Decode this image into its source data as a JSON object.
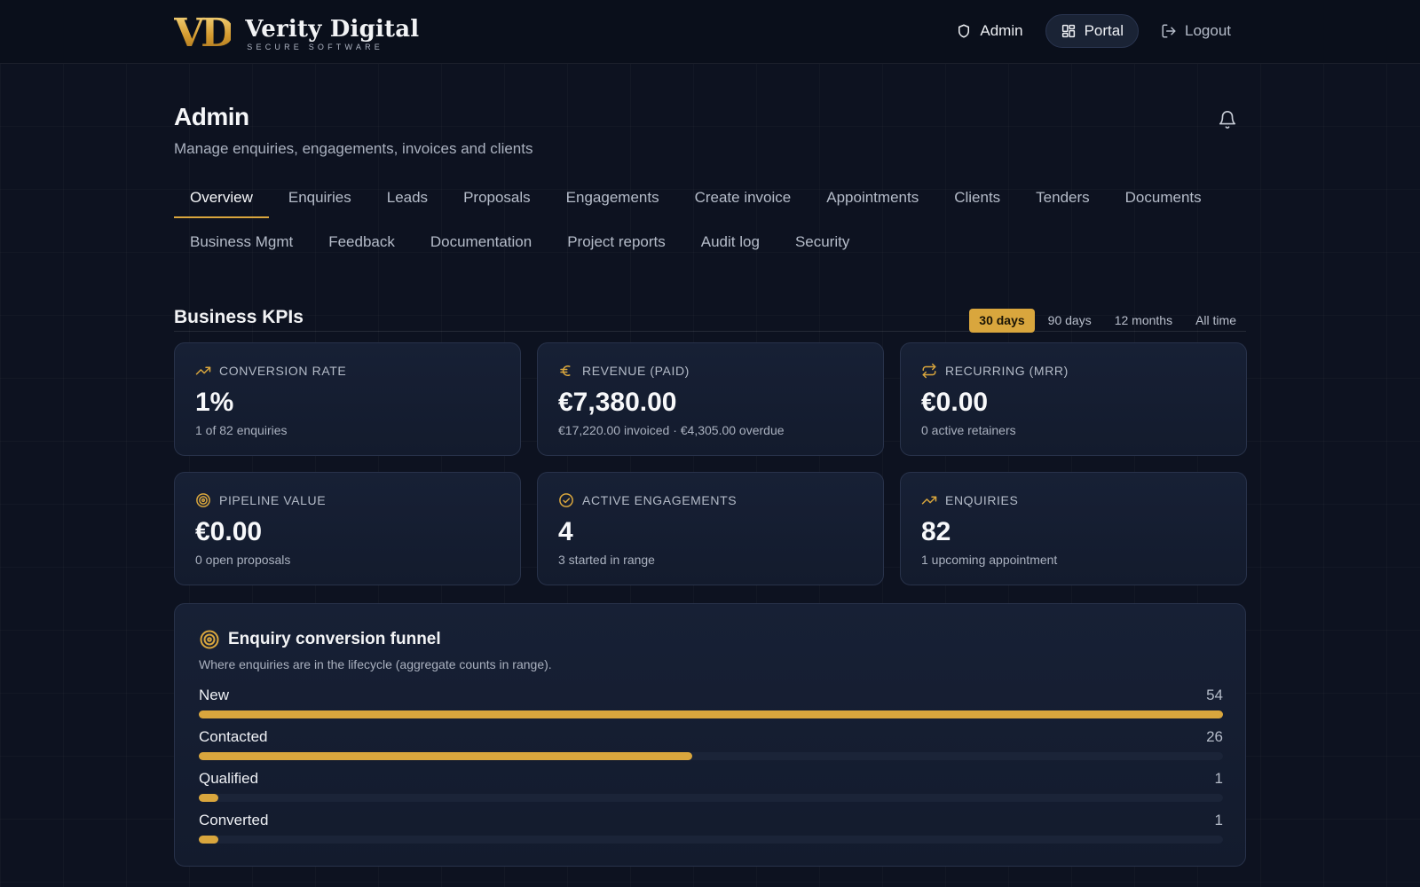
{
  "brand": {
    "mark": "VD",
    "name": "Verity Digital",
    "tagline": "SECURE SOFTWARE",
    "accent": "#d9a63d"
  },
  "topnav": [
    {
      "label": "Admin",
      "icon": "shield-icon"
    },
    {
      "label": "Portal",
      "icon": "grid-icon",
      "active": true
    },
    {
      "label": "Logout",
      "icon": "logout-icon"
    }
  ],
  "page": {
    "title": "Admin",
    "subtitle": "Manage enquiries, engagements, invoices and clients"
  },
  "tabs": {
    "row1": [
      "Overview",
      "Enquiries",
      "Leads",
      "Proposals",
      "Engagements",
      "Create invoice",
      "Appointments",
      "Clients",
      "Tenders",
      "Documents"
    ],
    "row2": [
      "Business Mgmt",
      "Feedback",
      "Documentation",
      "Project reports",
      "Audit log",
      "Security"
    ],
    "active": "Overview"
  },
  "kpis": {
    "title": "Business KPIs",
    "ranges": [
      "30 days",
      "90 days",
      "12 months",
      "All time"
    ],
    "active_range": "30 days",
    "cards": [
      {
        "label": "CONVERSION RATE",
        "icon": "trending-up-icon",
        "value": "1%",
        "sub": "1 of 82 enquiries"
      },
      {
        "label": "REVENUE (PAID)",
        "icon": "euro-icon",
        "value": "€7,380.00",
        "sub": "€17,220.00 invoiced · €4,305.00 overdue"
      },
      {
        "label": "RECURRING (MRR)",
        "icon": "repeat-icon",
        "value": "€0.00",
        "sub": "0 active retainers"
      },
      {
        "label": "PIPELINE VALUE",
        "icon": "target-icon",
        "value": "€0.00",
        "sub": "0 open proposals"
      },
      {
        "label": "ACTIVE ENGAGEMENTS",
        "icon": "check-circle-icon",
        "value": "4",
        "sub": "3 started in range"
      },
      {
        "label": "ENQUIRIES",
        "icon": "trending-up-icon",
        "value": "82",
        "sub": "1 upcoming appointment"
      }
    ]
  },
  "funnel": {
    "title": "Enquiry conversion funnel",
    "description": "Where enquiries are in the lifecycle (aggregate counts in range).",
    "rows": [
      {
        "label": "New",
        "count": 54
      },
      {
        "label": "Contacted",
        "count": 26
      },
      {
        "label": "Qualified",
        "count": 1
      },
      {
        "label": "Converted",
        "count": 1
      }
    ]
  }
}
